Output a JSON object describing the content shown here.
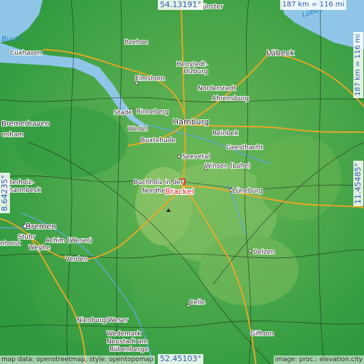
{
  "map": {
    "highlight_place": "Brackel",
    "sea_label": "Bucht",
    "sea_label_2": "Lübec",
    "cities": {
      "hamburg": "Hamburg",
      "luebeck": "Lübeck",
      "bremen": "Bremen",
      "bremerhaven": "Bremerhaven",
      "cuxhaven": "Cuxhaven",
      "itzehoe": "Itzehoe",
      "neumuenster": "Neumünster",
      "henstedt": "Henstedt-\nUlzburg",
      "henstedt_1": "Henstedt-",
      "henstedt_2": "Ulzburg",
      "elmshorn": "Elmshorn",
      "norderstedt": "Norderstedt",
      "ahrensburg": "Ahrensburg",
      "pinneberg": "Pinneberg",
      "stade": "Stade",
      "wedel": "Wedel",
      "buxtehude": "Buxtehude",
      "reinbek": "Reinbek",
      "geesthacht": "Geesthacht",
      "seevetal": "Seevetal",
      "winsen": "Winsen (Luhe)",
      "buchholz": "Buchholz in der",
      "nordheide": "Nordheide",
      "lueneburg": "Lüneburg",
      "uelzen": "Uelzen",
      "osterholz": "Osterholz-",
      "scharmbeck": "Scharmbeck",
      "stuhr": "Stuhr",
      "achim": "Achim (Weser)",
      "weyhe": "Weyhe",
      "verden": "Verden",
      "nienburg": "Nienburg/Weser",
      "wedemark": "Wedemark",
      "neustadt": "Neustadt am",
      "ruebenberge": "Rübenberge",
      "celle": "Celle",
      "gifhorn": "Gifhorn",
      "enham": "enham",
      "nhorst": "nhorst"
    }
  },
  "coords": {
    "top_lat": "54.13191°",
    "bottom_lat": "52.45103°",
    "left_lon": "8.64235°",
    "right_lon": "11.45485°",
    "scale_top": "187 km = 116 mi",
    "scale_right": "187 km = 116 mi"
  },
  "credits": {
    "left": "map data: openstreetmap, style: opentopomap",
    "right": "image: proc.: elevation.city"
  },
  "colors": {
    "sea": "#8fc6e8",
    "land_green": "#3fa548",
    "land_light": "#7fbf5a",
    "road_motorway": "#f5a623",
    "road_minor": "#1f2f1f",
    "highlight": "#e0262b"
  }
}
